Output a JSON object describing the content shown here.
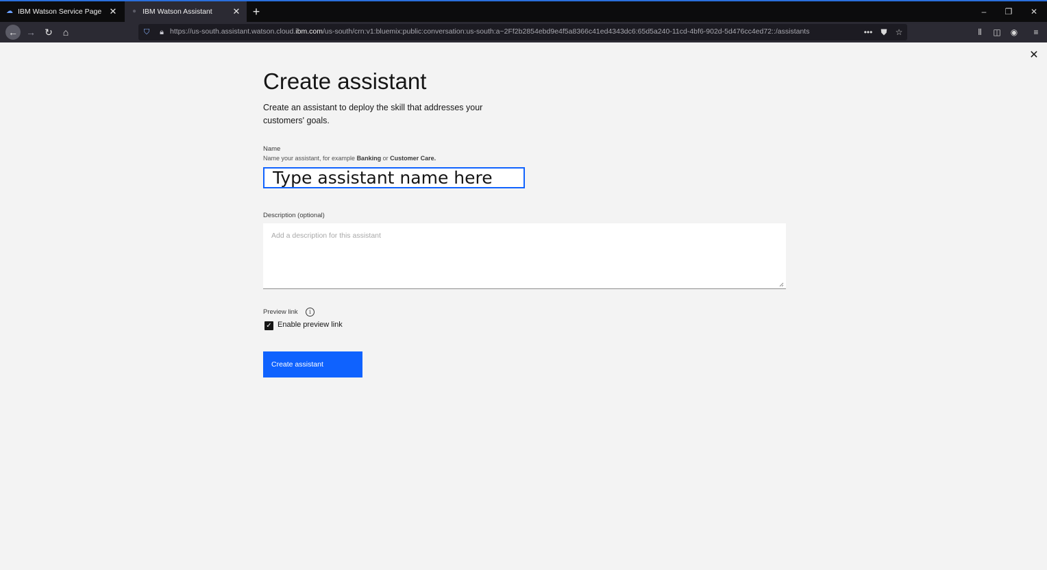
{
  "browser": {
    "tabs": [
      {
        "label": "IBM Watson Service Page",
        "active": false
      },
      {
        "label": "IBM Watson Assistant",
        "active": true
      }
    ],
    "url_prefix": "https://us-south.assistant.watson.cloud.",
    "url_host": "ibm.com",
    "url_path": "/us-south/crn:v1:bluemix:public:conversation:us-south:a~2Ff2b2854ebd9e4f5a8366c41ed4343dc6:65d5a240-11cd-4bf6-902d-5d476cc4ed72::/assistants",
    "accent_color": "#2a6fdc"
  },
  "page": {
    "title": "Create assistant",
    "subtitle": "Create an assistant to deploy the skill that addresses your customers' goals.",
    "name_label": "Name",
    "name_helper_prefix": "Name your assistant, for example ",
    "name_helper_bold1": "Banking",
    "name_helper_mid": " or ",
    "name_helper_bold2": "Customer Care",
    "name_helper_suffix": ".",
    "name_value": "Type assistant name here",
    "description_label": "Description (optional)",
    "description_placeholder": "Add a description for this assistant",
    "preview_label": "Preview link",
    "preview_checkbox_label": "Enable preview link",
    "preview_checked": true,
    "submit_label": "Create assistant",
    "primary_color": "#0f62fe"
  }
}
